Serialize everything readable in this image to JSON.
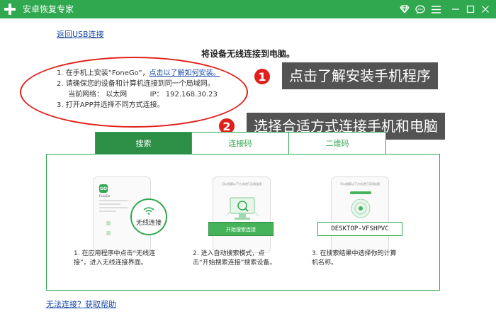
{
  "app": {
    "title": "安卓恢复专家"
  },
  "nav": {
    "back_label": "返回USB连接"
  },
  "page": {
    "title": "将设备无线连接到电脑。"
  },
  "steps": {
    "s1_prefix": "1.  在手机上安装“FoneGo”，",
    "s1_link": "点击以了解如何安装。",
    "s2": "2.  请确保您的设备和计算机连接到同一个局域网。",
    "s2_network_label": "当前网络：",
    "s2_network_value": "以太网",
    "s2_ip_label": "IP：",
    "s2_ip_value": "192.168.30.23",
    "s3": "3.  打开APP并选择不同方式连接。"
  },
  "callouts": [
    {
      "number": "1",
      "text": "点击了解安装手机程序"
    },
    {
      "number": "2",
      "text": "选择合适方式连接手机和电脑"
    }
  ],
  "tabs": [
    {
      "label": "搜索",
      "active": true
    },
    {
      "label": "连接码",
      "active": false
    },
    {
      "label": "二维码",
      "active": false
    }
  ],
  "illustrations": {
    "phone1_logo": "GO",
    "phone1_app_name": "FoneGo",
    "wifi_label": "无线连接",
    "phone2_header": "可以搜索以下方式进行无线连接",
    "phone2_button": "开始搜索连接",
    "phone3_header": "可以搜索以下方式进行无线连接",
    "device_name": "DESKTOP-VFSHPVC"
  },
  "captions": {
    "c1_line1": "1.  在应用程序中点击“无线连",
    "c1_line2": "接”，进入无线连接界面。",
    "c2_line1": "2.  进入自动搜索模式，点",
    "c2_line2": "击“开始搜索连接”搜索设备。",
    "c3_line1": "3.  在搜索结果中选择你的计算",
    "c3_line2": "机名称。"
  },
  "footer": {
    "help_label": "无法连接？获取帮助"
  },
  "colors": {
    "brand_green": "#2fa84f",
    "tab_active": "#2c8f45",
    "annotation_red": "#e0201a",
    "link_blue": "#1a4aa8"
  }
}
